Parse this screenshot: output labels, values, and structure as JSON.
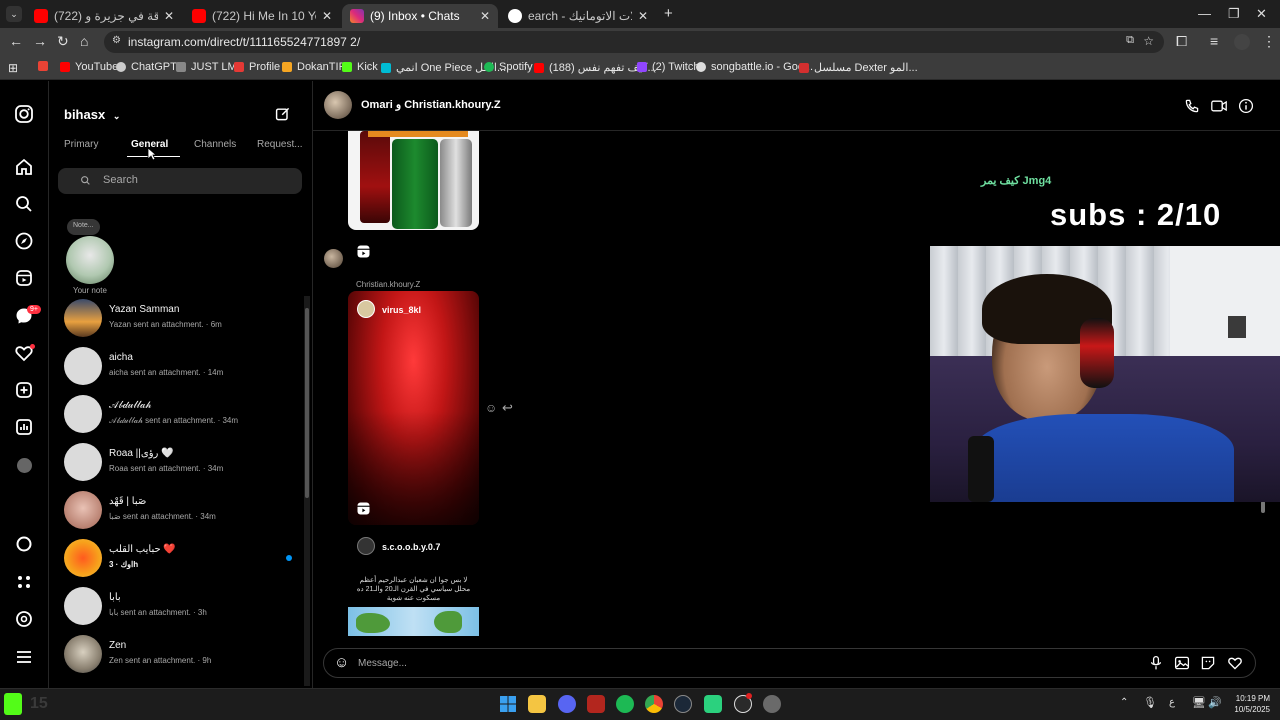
{
  "browser": {
    "tabs": [
      {
        "title": "(722) جمعت الافرقة في جزيرة و...",
        "color": "#ff0000"
      },
      {
        "title": "(722) Hi Me In 10 Years - YouTu",
        "color": "#ff0000"
      },
      {
        "title": "(9) Inbox • Chats",
        "color": "#e1306c"
      },
      {
        "title": "earch - طول العسالات الاتومانيك",
        "color": "#4285f4"
      }
    ],
    "url": "instagram.com/direct/t/111165524771897 2/",
    "bookmarks": [
      {
        "label": "YouTube",
        "color": "#ff0000"
      },
      {
        "label": "ChatGPT",
        "color": "#cccccc"
      },
      {
        "label": "JUST LMS",
        "color": "#cccccc"
      },
      {
        "label": "Profile",
        "color": "#e53935"
      },
      {
        "label": "DokanTIP",
        "color": "#f6a623"
      },
      {
        "label": "Kick",
        "color": "#53fc18"
      },
      {
        "label": "انمي One Piece الحل...",
        "color": "#00bcd4"
      },
      {
        "label": "Spotify",
        "color": "#1db954"
      },
      {
        "label": "(188) كيف تفهم نفس...",
        "color": "#ff0000"
      },
      {
        "label": "(2) Twitch",
        "color": "#9146ff"
      },
      {
        "label": "songbattle.io - Goo...",
        "color": "#cccccc"
      },
      {
        "label": "مسلسل Dexter المو...",
        "color": "#d32f2f"
      }
    ]
  },
  "list": {
    "username": "bihasx",
    "tabs": [
      "Primary",
      "General",
      "Channels",
      "Request..."
    ],
    "search_placeholder": "Search",
    "note_bubble": "Note...",
    "your_note": "Your note",
    "conversations": [
      {
        "name": "Yazan Samman",
        "sub": "Yazan sent an attachment. · 6m",
        "avatar": "#c98a3e"
      },
      {
        "name": "aicha",
        "sub": "aicha sent an attachment. · 14m",
        "avatar": "#dbdbdb"
      },
      {
        "name": "𝒜𝒷𝒹𝓊𝓁𝓁𝒶𝒽",
        "sub": "𝒜𝒷𝒹𝓊𝓁𝓁𝒶𝒽 sent an attachment. · 34m",
        "avatar": "#dbdbdb"
      },
      {
        "name": "Roaa ||رؤى 🤍",
        "sub": "Roaa sent an attachment. · 34m",
        "avatar": "#dbdbdb"
      },
      {
        "name": "صَبا | قَهْد",
        "sub": "صَبا sent an attachment. · 34m",
        "avatar": "#c8a59a"
      },
      {
        "name": "حبايب القلب ❤️",
        "sub": "اوك · 3h",
        "avatar": "#f7a21b"
      },
      {
        "name": "بابا",
        "sub": "بابا sent an attachment. · 3h",
        "avatar": "#dbdbdb"
      },
      {
        "name": "Zen",
        "sub": "Zen sent an attachment. · 9h",
        "avatar": "#8a8a8a"
      }
    ]
  },
  "chat": {
    "title": "Omari و Christian.khoury.Z",
    "sender_label": "Christian.khoury.Z",
    "reel_user": "virus_8kl",
    "post_user": "s.c.o.o.b.y.0.7",
    "post_caption": "لا بس جوا ان شعبان عبدالرحيم أعظم محلل سياسي في القرن الـ20 والـ21 ده مسكوت عنه شوية",
    "composer_placeholder": "Message..."
  },
  "overlay": {
    "small": "كيف يمر Jmg4",
    "subs": "subs : 2/10"
  },
  "system": {
    "time": "10:19 PM",
    "date": "10/5/2025",
    "lang": "ع",
    "kick_count": "15"
  },
  "colors": {
    "instagram_blue": "#0095f6",
    "badge_red": "#ff3040"
  }
}
